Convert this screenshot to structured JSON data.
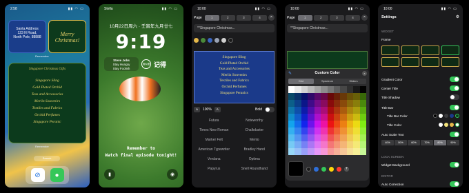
{
  "phone1": {
    "time": "2:58",
    "address_lines": [
      "Santa Address",
      "123 N Road,",
      "North Pole, 88888"
    ],
    "merry_text": "Merry Christmas!",
    "widget_label_small": "Remember",
    "big_title": "Singapore Christmas Gifts",
    "big_items": [
      "Singapore Sling",
      "Gold Plated Orchid",
      "Teas and Accessories",
      "Merlin Souvenirs",
      "Textiles and Fabrics",
      "Orchid Perfumes",
      "Singapore Peranic"
    ],
    "widget_label_big": "Remember",
    "search_label": "Search",
    "safari_icon": "compass-icon",
    "messages_icon": "message-bubble-icon"
  },
  "phone2": {
    "carrier": "Stella",
    "date": "10月22日周六 · 壬寅年九月廿七",
    "time": "9:19",
    "widget_name": "Steve Jobs",
    "widget_lines": [
      "Stay Hungry",
      "Stay Foolish"
    ],
    "mini_label": "相似度",
    "jiji": "记得",
    "reminder": [
      "Remember to",
      "Watch final episode tonight!"
    ]
  },
  "phone3": {
    "time": "10:00",
    "page_label": "Page",
    "pages": [
      "1",
      "2",
      "3",
      "4"
    ],
    "text_value": "**Singapore Christmas...",
    "size_label": "100%",
    "bold_label": "Bold",
    "preview_items": [
      "Singapore Sling",
      "Gold Plated Orchid",
      "Teas and Accessories",
      "Merlin Souvenirs",
      "Textiles and Fabrics",
      "Orchid Perfumes",
      "Singapore Peranics"
    ],
    "fonts": [
      "Futura",
      "Noteworthy",
      "Times New Roman",
      "Chalkduster",
      "Marker Felt",
      "Menlo",
      "American Typewriter",
      "Bradley Hand",
      "Verdana",
      "Optima",
      "Papyrus",
      "Snell Roundhand"
    ],
    "swatches": [
      "#e5b84a",
      "#4a8a3a",
      "#3a66c0",
      "#9aa3b5",
      "#d0d0d0",
      "#1a1a1a"
    ]
  },
  "phone4": {
    "time": "10:00",
    "page_label": "Page",
    "pages": [
      "1",
      "2",
      "3",
      "4"
    ],
    "text_value": "**Singapore Christmas...",
    "dialog_title": "Custom Color",
    "tabs": [
      "Grid",
      "Spectrum",
      "Sliders"
    ],
    "recent_colors": [
      "#1a1a1a",
      "#2f6fd8",
      "#34c759",
      "#ffd60a",
      "#ff3b30"
    ],
    "add_icon": "plus-icon"
  },
  "phone5": {
    "time": "10:00",
    "title": "Settings",
    "sections": {
      "widget": "WIDGET",
      "lock": "LOCK SCREEN",
      "editor": "EDITOR"
    },
    "rows": {
      "frame": "Frame",
      "gradient": "Gradient Color",
      "center": "Center Title",
      "shadow": "Title Shadow",
      "titlebar": "Title Bar",
      "titlebar_color": "Title Bar Color",
      "title_color": "Title Color",
      "autoscale": "Auto Scale Text",
      "widget_bg": "Widget Background",
      "autocorrect": "Auto Correction"
    },
    "percents": [
      "40%",
      "50%",
      "60%",
      "70%",
      "80%",
      "90%"
    ],
    "selected_percent": "80%",
    "titlebar_colors": [
      "#000000",
      "#ffffff",
      "#3a3a3c",
      "#1b3a8a",
      "#0c3a1c"
    ],
    "title_colors": [
      "#ffffff",
      "#f2e27a",
      "#e5b84a",
      "#ffffff"
    ]
  }
}
